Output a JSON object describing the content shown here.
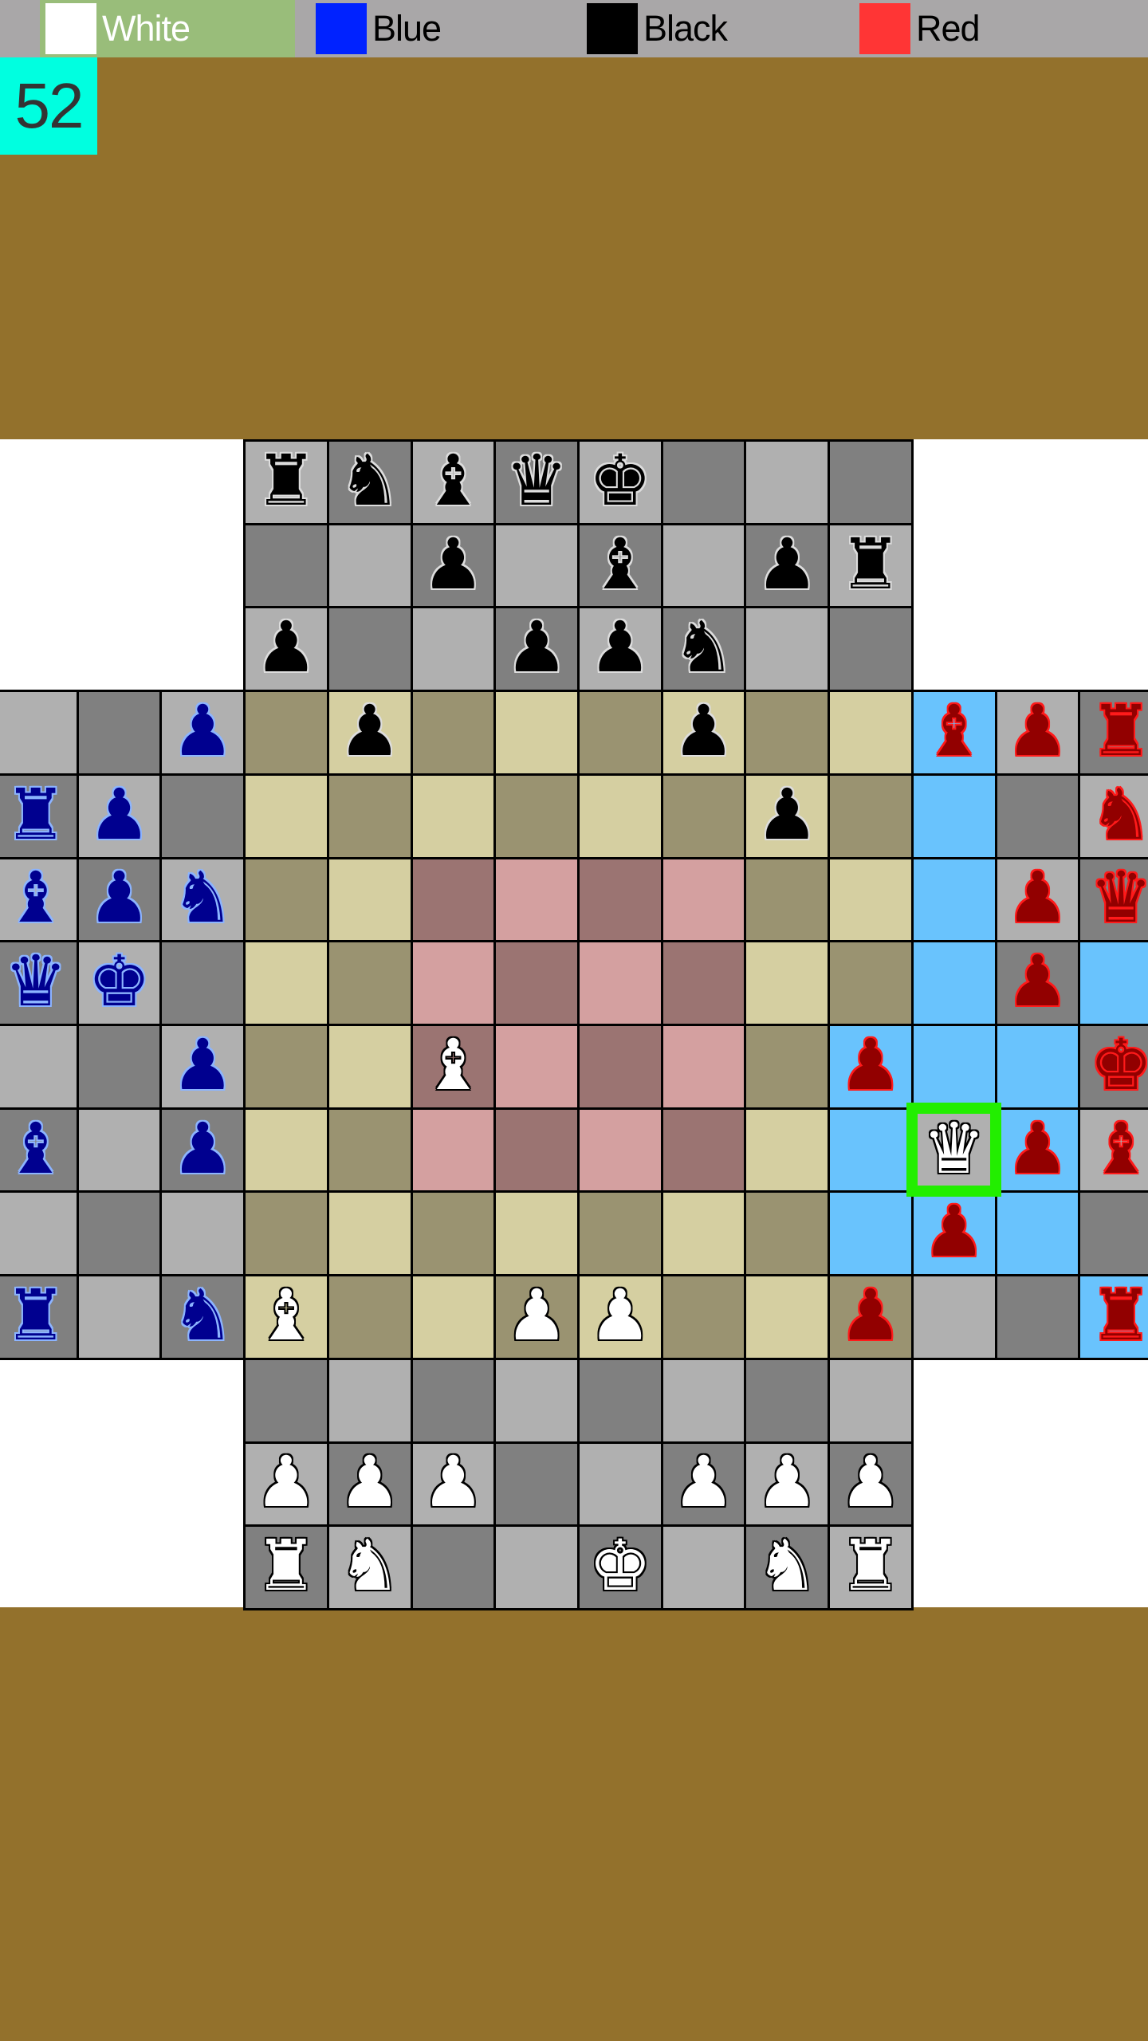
{
  "players": [
    {
      "name": "White",
      "color": "#ffffff",
      "active": true
    },
    {
      "name": "Blue",
      "color": "#0022ff",
      "active": false
    },
    {
      "name": "Black",
      "color": "#000000",
      "active": false
    },
    {
      "name": "Red",
      "color": "#ff3535",
      "active": false
    }
  ],
  "move_counter": "52",
  "colors": {
    "background": "#93712c",
    "gray_light": "#b0b0b0",
    "gray_dark": "#808080",
    "tan_light": "#d5cfa1",
    "tan_dark": "#9a9371",
    "pink_light": "#d4a0a0",
    "pink_dark": "#9b7472",
    "move_highlight": "#69c3fd",
    "selected_border": "#22ee00"
  },
  "board": {
    "size": 14,
    "corner_size": 3,
    "pieces": [
      {
        "row": 0,
        "col": 3,
        "owner": "black",
        "type": "rook"
      },
      {
        "row": 0,
        "col": 4,
        "owner": "black",
        "type": "knight"
      },
      {
        "row": 0,
        "col": 5,
        "owner": "black",
        "type": "bishop"
      },
      {
        "row": 0,
        "col": 6,
        "owner": "black",
        "type": "queen"
      },
      {
        "row": 0,
        "col": 7,
        "owner": "black",
        "type": "king"
      },
      {
        "row": 1,
        "col": 5,
        "owner": "black",
        "type": "pawn"
      },
      {
        "row": 1,
        "col": 7,
        "owner": "black",
        "type": "bishop"
      },
      {
        "row": 1,
        "col": 9,
        "owner": "black",
        "type": "pawn"
      },
      {
        "row": 1,
        "col": 10,
        "owner": "black",
        "type": "rook"
      },
      {
        "row": 2,
        "col": 3,
        "owner": "black",
        "type": "pawn"
      },
      {
        "row": 2,
        "col": 6,
        "owner": "black",
        "type": "pawn"
      },
      {
        "row": 2,
        "col": 7,
        "owner": "black",
        "type": "pawn"
      },
      {
        "row": 2,
        "col": 8,
        "owner": "black",
        "type": "knight"
      },
      {
        "row": 3,
        "col": 4,
        "owner": "black",
        "type": "pawn"
      },
      {
        "row": 3,
        "col": 8,
        "owner": "black",
        "type": "pawn"
      },
      {
        "row": 4,
        "col": 9,
        "owner": "black",
        "type": "pawn"
      },
      {
        "row": 3,
        "col": 2,
        "owner": "blue",
        "type": "pawn"
      },
      {
        "row": 4,
        "col": 0,
        "owner": "blue",
        "type": "rook"
      },
      {
        "row": 4,
        "col": 1,
        "owner": "blue",
        "type": "pawn"
      },
      {
        "row": 5,
        "col": 0,
        "owner": "blue",
        "type": "bishop"
      },
      {
        "row": 5,
        "col": 1,
        "owner": "blue",
        "type": "pawn"
      },
      {
        "row": 5,
        "col": 2,
        "owner": "blue",
        "type": "knight"
      },
      {
        "row": 6,
        "col": 0,
        "owner": "blue",
        "type": "queen"
      },
      {
        "row": 6,
        "col": 1,
        "owner": "blue",
        "type": "king"
      },
      {
        "row": 7,
        "col": 2,
        "owner": "blue",
        "type": "pawn"
      },
      {
        "row": 8,
        "col": 0,
        "owner": "blue",
        "type": "bishop"
      },
      {
        "row": 8,
        "col": 2,
        "owner": "blue",
        "type": "pawn"
      },
      {
        "row": 10,
        "col": 0,
        "owner": "blue",
        "type": "rook"
      },
      {
        "row": 10,
        "col": 2,
        "owner": "blue",
        "type": "knight"
      },
      {
        "row": 3,
        "col": 11,
        "owner": "red",
        "type": "bishop"
      },
      {
        "row": 3,
        "col": 12,
        "owner": "red",
        "type": "pawn"
      },
      {
        "row": 3,
        "col": 13,
        "owner": "red",
        "type": "rook"
      },
      {
        "row": 4,
        "col": 13,
        "owner": "red",
        "type": "knight"
      },
      {
        "row": 5,
        "col": 12,
        "owner": "red",
        "type": "pawn"
      },
      {
        "row": 5,
        "col": 13,
        "owner": "red",
        "type": "queen"
      },
      {
        "row": 6,
        "col": 12,
        "owner": "red",
        "type": "pawn"
      },
      {
        "row": 7,
        "col": 10,
        "owner": "red",
        "type": "pawn"
      },
      {
        "row": 7,
        "col": 13,
        "owner": "red",
        "type": "king"
      },
      {
        "row": 8,
        "col": 12,
        "owner": "red",
        "type": "pawn"
      },
      {
        "row": 8,
        "col": 13,
        "owner": "red",
        "type": "bishop"
      },
      {
        "row": 9,
        "col": 11,
        "owner": "red",
        "type": "pawn"
      },
      {
        "row": 10,
        "col": 10,
        "owner": "red",
        "type": "pawn"
      },
      {
        "row": 10,
        "col": 13,
        "owner": "red",
        "type": "rook"
      },
      {
        "row": 7,
        "col": 5,
        "owner": "white",
        "type": "bishop"
      },
      {
        "row": 8,
        "col": 11,
        "owner": "white",
        "type": "queen"
      },
      {
        "row": 10,
        "col": 3,
        "owner": "white",
        "type": "bishop"
      },
      {
        "row": 10,
        "col": 6,
        "owner": "white",
        "type": "pawn"
      },
      {
        "row": 10,
        "col": 7,
        "owner": "white",
        "type": "pawn"
      },
      {
        "row": 12,
        "col": 3,
        "owner": "white",
        "type": "pawn"
      },
      {
        "row": 12,
        "col": 4,
        "owner": "white",
        "type": "pawn"
      },
      {
        "row": 12,
        "col": 5,
        "owner": "white",
        "type": "pawn"
      },
      {
        "row": 12,
        "col": 8,
        "owner": "white",
        "type": "pawn"
      },
      {
        "row": 12,
        "col": 9,
        "owner": "white",
        "type": "pawn"
      },
      {
        "row": 12,
        "col": 10,
        "owner": "white",
        "type": "pawn"
      },
      {
        "row": 13,
        "col": 3,
        "owner": "white",
        "type": "rook"
      },
      {
        "row": 13,
        "col": 4,
        "owner": "white",
        "type": "knight"
      },
      {
        "row": 13,
        "col": 7,
        "owner": "white",
        "type": "king"
      },
      {
        "row": 13,
        "col": 9,
        "owner": "white",
        "type": "knight"
      },
      {
        "row": 13,
        "col": 10,
        "owner": "white",
        "type": "rook"
      }
    ],
    "selected": {
      "row": 8,
      "col": 11
    },
    "move_highlights": [
      [
        3,
        11
      ],
      [
        4,
        11
      ],
      [
        5,
        11
      ],
      [
        6,
        11
      ],
      [
        6,
        13
      ],
      [
        7,
        10
      ],
      [
        7,
        11
      ],
      [
        7,
        12
      ],
      [
        8,
        10
      ],
      [
        8,
        12
      ],
      [
        9,
        10
      ],
      [
        9,
        11
      ],
      [
        9,
        12
      ],
      [
        10,
        13
      ]
    ],
    "center_pink_region": {
      "row_from": 5,
      "row_to": 8,
      "col_from": 5,
      "col_to": 8
    }
  },
  "piece_glyphs": {
    "king": "♚",
    "queen": "♛",
    "rook": "♜",
    "bishop": "♝",
    "knight": "♞",
    "pawn": "♟"
  }
}
